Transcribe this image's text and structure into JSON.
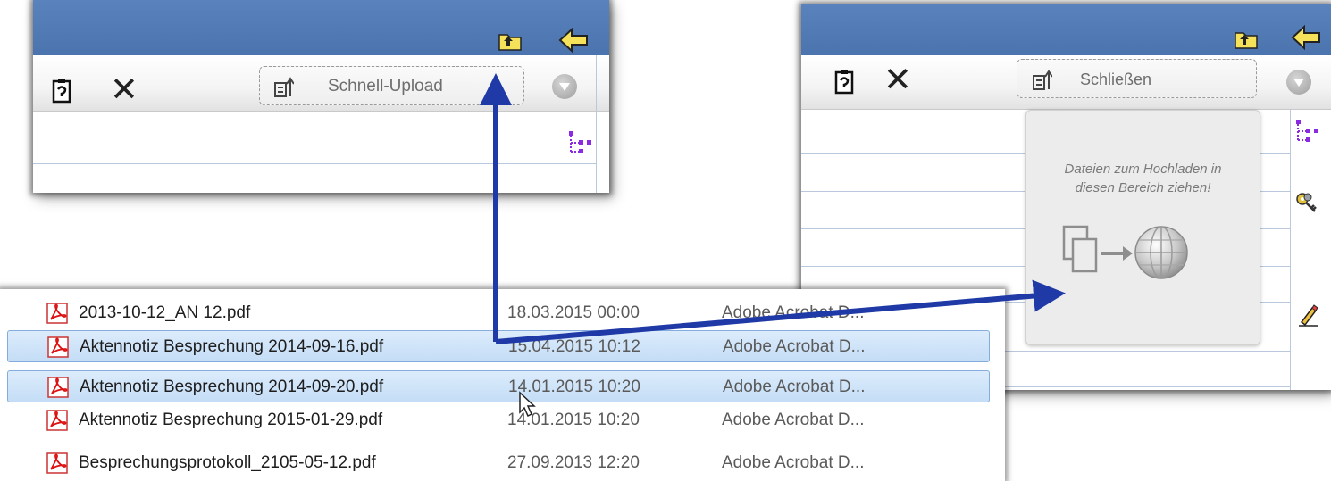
{
  "left_panel": {
    "upload_label": "Schnell-Upload",
    "icons": [
      "folder-up-icon",
      "back-arrow-icon",
      "clipboard-icon",
      "close-icon",
      "upload-icon",
      "dropdown-icon",
      "tree-icon"
    ]
  },
  "right_panel": {
    "close_label": "Schließen",
    "dropzone_text_line1": "Dateien zum Hochladen in",
    "dropzone_text_line2": "diesen Bereich ziehen!",
    "icons": [
      "folder-up-icon",
      "back-arrow-icon",
      "clipboard-icon",
      "close-icon",
      "upload-icon",
      "dropdown-icon",
      "tree-icon",
      "keys-icon",
      "pen-icon",
      "documents-icon",
      "globe-icon"
    ]
  },
  "files": [
    {
      "name": "2013-10-12_AN 12.pdf",
      "date": "18.03.2015 00:00",
      "type": "Adobe Acrobat D...",
      "selected": false
    },
    {
      "name": "Aktennotiz Besprechung 2014-09-16.pdf",
      "date": "15.04.2015 10:12",
      "type": "Adobe Acrobat D...",
      "selected": true
    },
    {
      "name": "Aktennotiz Besprechung 2014-09-20.pdf",
      "date": "14.01.2015 10:20",
      "type": "Adobe Acrobat D...",
      "selected": true
    },
    {
      "name": "Aktennotiz Besprechung 2015-01-29.pdf",
      "date": "14.01.2015 10:20",
      "type": "Adobe Acrobat D...",
      "selected": false
    },
    {
      "name": "Besprechungsprotokoll_2105-05-12.pdf",
      "date": "27.09.2013 12:20",
      "type": "Adobe Acrobat D...",
      "selected": false
    }
  ],
  "colors": {
    "header_blue": "#4e76b0",
    "arrow_blue": "#1f3aa6",
    "selection": "#c9e0f7"
  }
}
